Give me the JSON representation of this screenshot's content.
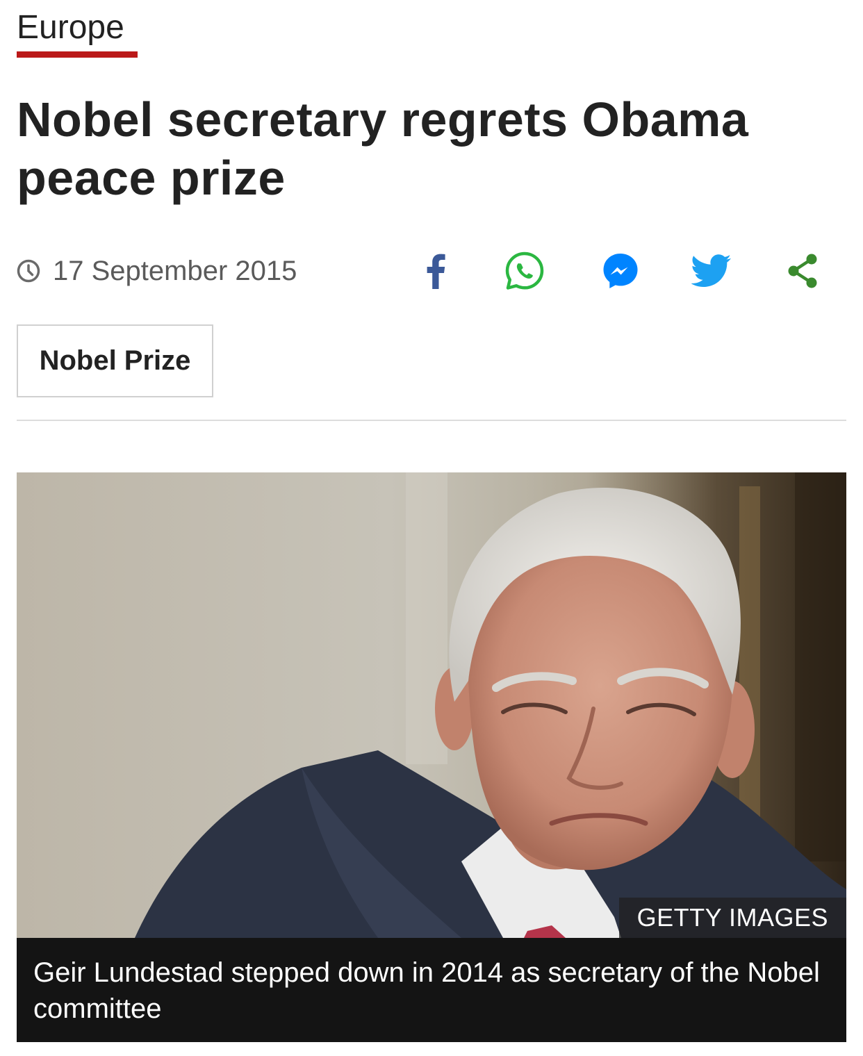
{
  "section": {
    "label": "Europe"
  },
  "article": {
    "headline": "Nobel secretary regrets Obama peace prize",
    "date": "17 September 2015"
  },
  "share_icons": [
    "facebook-icon",
    "whatsapp-icon",
    "messenger-icon",
    "twitter-icon",
    "share-icon"
  ],
  "colors": {
    "section_underline": "#bb1919",
    "facebook": "#3b5998",
    "whatsapp": "#2bb741",
    "messenger": "#0084ff",
    "twitter": "#1da1f2",
    "share": "#3a8a2e"
  },
  "topic_tag": {
    "label": "Nobel Prize"
  },
  "image": {
    "credit": "GETTY IMAGES",
    "caption": "Geir Lundestad stepped down in 2014 as secretary of the Nobel committee"
  }
}
